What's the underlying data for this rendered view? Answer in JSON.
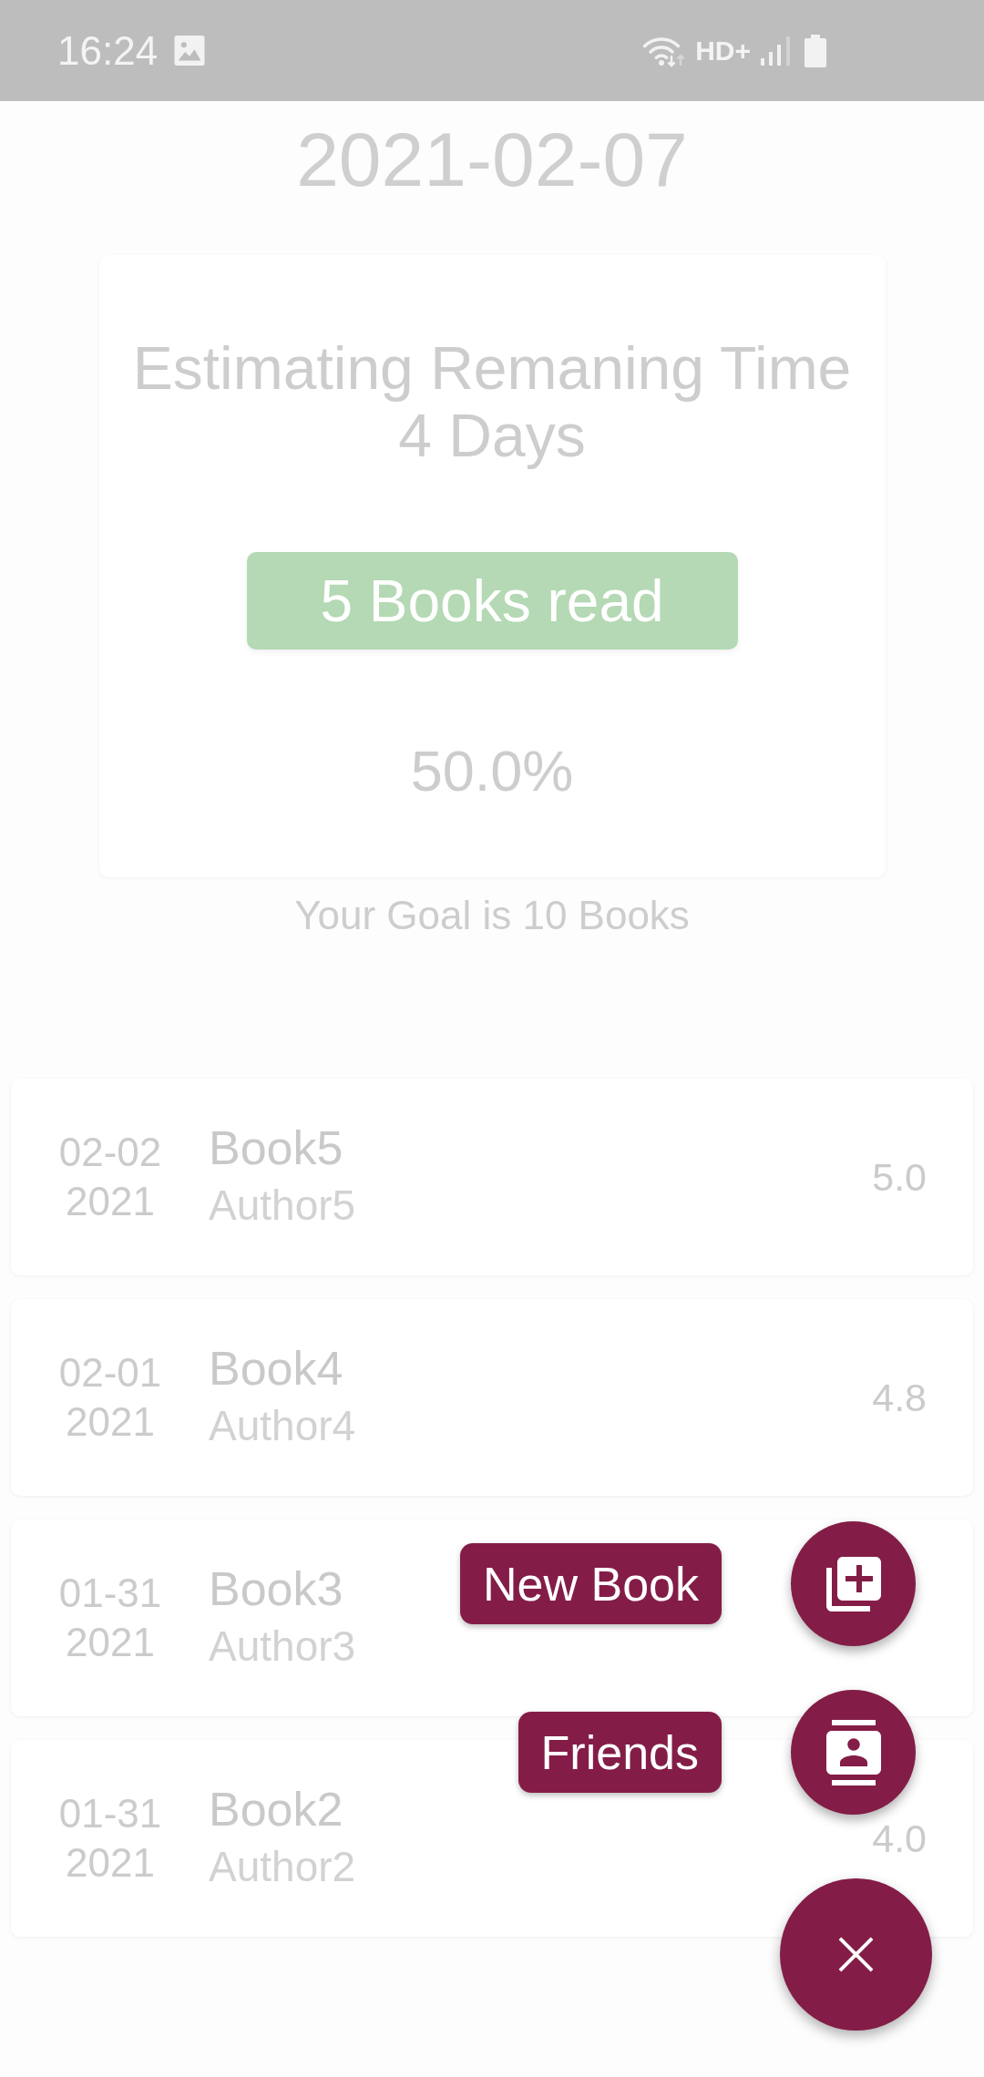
{
  "status_bar": {
    "time": "16:24",
    "network_label": "HD+"
  },
  "date_header": "2021-02-07",
  "summary_card": {
    "estimate_label": "Estimating Remaning Time",
    "estimate_value": "4 Days",
    "books_read": "5 Books read",
    "progress_percent": "50.0%"
  },
  "goal": "Your Goal is 10 Books",
  "books": [
    {
      "date": "02-02",
      "year": "2021",
      "title": "Book5",
      "author": "Author5",
      "rating": "5.0"
    },
    {
      "date": "02-01",
      "year": "2021",
      "title": "Book4",
      "author": "Author4",
      "rating": "4.8"
    },
    {
      "date": "01-31",
      "year": "2021",
      "title": "Book3",
      "author": "Author3"
    },
    {
      "date": "01-31",
      "year": "2021",
      "title": "Book2",
      "author": "Author2",
      "rating": "4.0"
    }
  ],
  "fab_menu": {
    "expanded": true,
    "actions": [
      {
        "kind": "new_book",
        "label": "New Book"
      },
      {
        "kind": "friends",
        "label": "Friends"
      }
    ]
  }
}
